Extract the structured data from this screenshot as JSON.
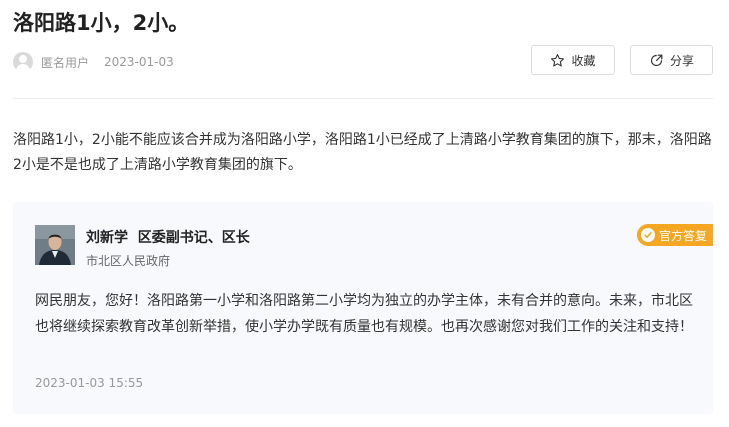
{
  "question": {
    "title": "洛阳路1小，2小。",
    "author": "匿名用户",
    "date": "2023-01-03",
    "body": "洛阳路1小，2小能不能应该合并成为洛阳路小学，洛阳路1小已经成了上清路小学教育集团的旗下，那末，洛阳路2小是不是也成了上清路小学教育集团的旗下。"
  },
  "actions": {
    "favorite_label": "收藏",
    "share_label": "分享"
  },
  "reply": {
    "responder_name": "刘新学",
    "responder_title": "区委副书记、区长",
    "organization": "市北区人民政府",
    "badge_label": "官方答复",
    "body": "网民朋友，您好！洛阳路第一小学和洛阳路第二小学均为独立的办学主体，未有合并的意向。未来，市北区也将继续探索教育改革创新举措，使小学办学既有质量也有规模。也再次感谢您对我们工作的关注和支持！",
    "time": "2023-01-03 15:55"
  },
  "icons": {
    "avatar": "user-avatar-icon",
    "favorite": "star-icon",
    "share": "share-icon",
    "badge": "check-circle-icon"
  },
  "colors": {
    "badge": "#f5a623",
    "reply_bg": "#f7f9fc"
  }
}
